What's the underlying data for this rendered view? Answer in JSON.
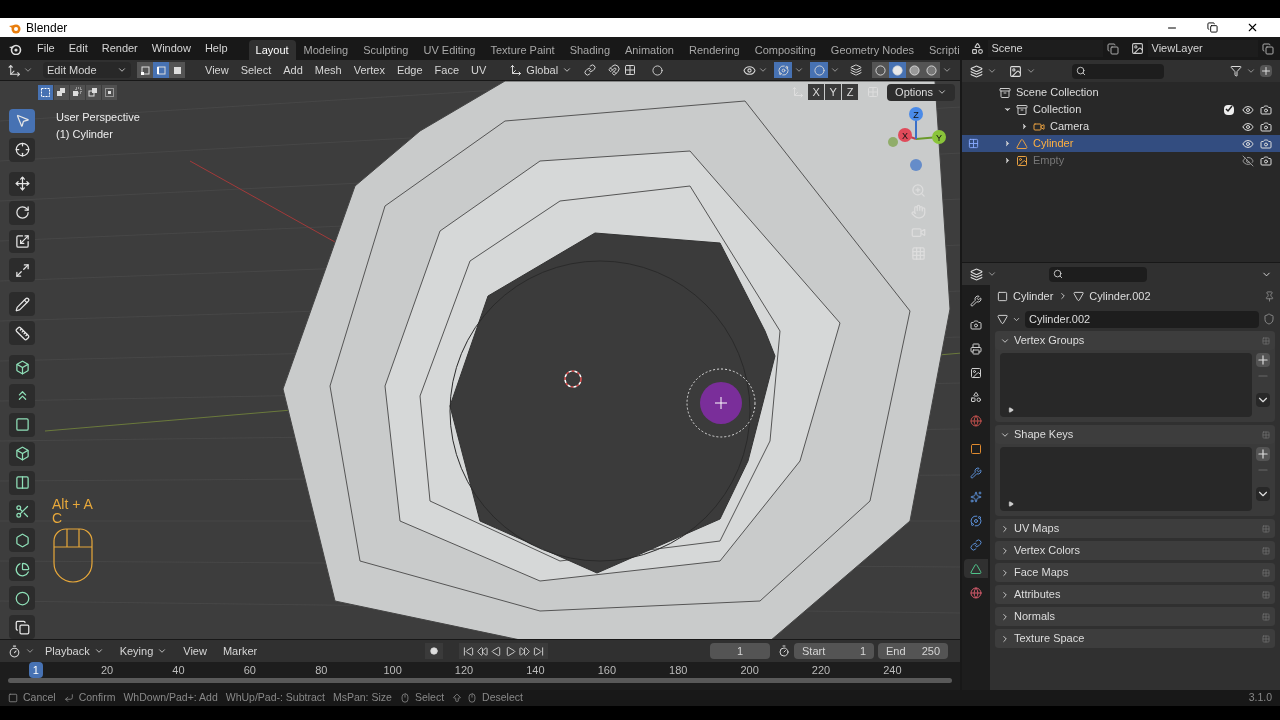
{
  "window": {
    "title": "Blender"
  },
  "menu_bar": {
    "menus": [
      "File",
      "Edit",
      "Render",
      "Window",
      "Help"
    ],
    "workspaces": [
      {
        "label": "Layout",
        "selected": true
      },
      {
        "label": "Modeling",
        "selected": false
      },
      {
        "label": "Sculpting",
        "selected": false
      },
      {
        "label": "UV Editing",
        "selected": false
      },
      {
        "label": "Texture Paint",
        "selected": false
      },
      {
        "label": "Shading",
        "selected": false
      },
      {
        "label": "Animation",
        "selected": false
      },
      {
        "label": "Rendering",
        "selected": false
      },
      {
        "label": "Compositing",
        "selected": false
      },
      {
        "label": "Geometry Nodes",
        "selected": false
      },
      {
        "label": "Scripti",
        "selected": false
      }
    ],
    "scene": "Scene",
    "view_layer": "ViewLayer"
  },
  "viewport": {
    "mode": "Edit Mode",
    "select_modes": [
      {
        "kind": "vertex",
        "selected": false
      },
      {
        "kind": "edge",
        "selected": true
      },
      {
        "kind": "face",
        "selected": false
      }
    ],
    "menus": [
      "View",
      "Select",
      "Add",
      "Mesh",
      "Vertex",
      "Edge",
      "Face",
      "UV"
    ],
    "orientation": "Global",
    "shading": [
      {
        "kind": "wireframe",
        "selected": false
      },
      {
        "kind": "solid",
        "selected": true
      },
      {
        "kind": "material",
        "selected": false
      },
      {
        "kind": "rendered",
        "selected": false
      }
    ],
    "box_modes": [
      {
        "kind": "set",
        "selected": true
      },
      {
        "kind": "extend",
        "selected": false
      },
      {
        "kind": "subtract",
        "selected": false
      },
      {
        "kind": "invert",
        "selected": false
      },
      {
        "kind": "intersect",
        "selected": false
      }
    ],
    "mirror_axes": [
      "X",
      "Y",
      "Z"
    ],
    "options": "Options",
    "view_name": "User Perspective",
    "object_name": "(1) Cylinder",
    "key_hint": [
      "Alt + A",
      "C"
    ],
    "gizmo_axes": [
      "X",
      "Y",
      "Z"
    ],
    "tools": [
      {
        "kind": "select",
        "selected": true
      },
      {
        "kind": "cursor",
        "selected": false
      },
      {
        "kind": "move",
        "selected": false
      },
      {
        "kind": "rotate",
        "selected": false
      },
      {
        "kind": "scale",
        "selected": false
      },
      {
        "kind": "transform",
        "selected": false
      },
      {
        "kind": "annotate",
        "selected": false
      },
      {
        "kind": "measure",
        "selected": false
      },
      {
        "kind": "add_cube",
        "selected": false
      },
      {
        "kind": "extrude",
        "selected": false
      },
      {
        "kind": "inset",
        "selected": false
      },
      {
        "kind": "bevel",
        "selected": false
      },
      {
        "kind": "loop_cut",
        "selected": false
      },
      {
        "kind": "knife",
        "selected": false
      },
      {
        "kind": "poly_build",
        "selected": false
      },
      {
        "kind": "spin",
        "selected": false
      },
      {
        "kind": "smooth",
        "selected": false
      },
      {
        "kind": "shear",
        "selected": false
      }
    ]
  },
  "outliner": {
    "tree": [
      {
        "label": "Scene Collection",
        "kind": "scene_collection",
        "selected": false,
        "children": [
          {
            "label": "Collection",
            "kind": "collection",
            "expanded": true,
            "checked": true,
            "visible": true,
            "selected": false,
            "children": [
              {
                "label": "Camera",
                "kind": "camera",
                "expanded": false,
                "visible": true,
                "selected": false,
                "editing": false
              }
            ]
          },
          {
            "label": "Cylinder",
            "kind": "mesh",
            "expanded": false,
            "visible": true,
            "selected": true,
            "editing": true
          },
          {
            "label": "Empty",
            "kind": "image",
            "expanded": false,
            "visible": false,
            "selected": false,
            "editing": false
          }
        ]
      }
    ]
  },
  "properties": {
    "tabs": [
      {
        "kind": "tool",
        "selected": false
      },
      {
        "kind": "render",
        "selected": false
      },
      {
        "kind": "output",
        "selected": false
      },
      {
        "kind": "view_layer",
        "selected": false
      },
      {
        "kind": "scene",
        "selected": false
      },
      {
        "kind": "world",
        "selected": false
      },
      {
        "kind": "object",
        "selected": false
      },
      {
        "kind": "modifiers",
        "selected": false
      },
      {
        "kind": "particles",
        "selected": false
      },
      {
        "kind": "physics",
        "selected": false
      },
      {
        "kind": "constraints",
        "selected": false
      },
      {
        "kind": "data",
        "selected": true
      },
      {
        "kind": "material",
        "selected": false
      }
    ],
    "breadcrumb": [
      "Cylinder",
      "Cylinder.002"
    ],
    "datablock": "Cylinder.002",
    "panels": [
      {
        "title": "Vertex Groups",
        "expanded": true
      },
      {
        "title": "Shape Keys",
        "expanded": true
      },
      {
        "title": "UV Maps",
        "expanded": false
      },
      {
        "title": "Vertex Colors",
        "expanded": false
      },
      {
        "title": "Face Maps",
        "expanded": false
      },
      {
        "title": "Attributes",
        "expanded": false
      },
      {
        "title": "Normals",
        "expanded": false
      },
      {
        "title": "Texture Space",
        "expanded": false
      }
    ]
  },
  "timeline": {
    "menus": [
      {
        "label": "Playback",
        "kind": "dropdown"
      },
      {
        "label": "Keying",
        "kind": "dropdown"
      },
      {
        "label": "View",
        "kind": "plain"
      },
      {
        "label": "Marker",
        "kind": "plain"
      }
    ],
    "current_frame": "1",
    "start_label": "Start",
    "start": "1",
    "end_label": "End",
    "end": "250",
    "ruler": [
      {
        "label": "1",
        "selected": true
      },
      {
        "label": "20",
        "selected": false
      },
      {
        "label": "40",
        "selected": false
      },
      {
        "label": "60",
        "selected": false
      },
      {
        "label": "80",
        "selected": false
      },
      {
        "label": "100",
        "selected": false
      },
      {
        "label": "120",
        "selected": false
      },
      {
        "label": "140",
        "selected": false
      },
      {
        "label": "160",
        "selected": false
      },
      {
        "label": "180",
        "selected": false
      },
      {
        "label": "200",
        "selected": false
      },
      {
        "label": "220",
        "selected": false
      },
      {
        "label": "240",
        "selected": false
      }
    ]
  },
  "status_bar": {
    "hints": [
      {
        "kind": "key",
        "label": "Cancel"
      },
      {
        "kind": "enter",
        "label": "Confirm"
      },
      {
        "kind": "text",
        "label": "WhDown/Pad+: Add"
      },
      {
        "kind": "text",
        "label": "WhUp/Pad-: Subtract"
      },
      {
        "kind": "text",
        "label": "MsPan: Size"
      },
      {
        "kind": "mouse",
        "label": "Select"
      },
      {
        "kind": "shift_mouse",
        "label": "Deselect"
      }
    ],
    "version": "3.1.0"
  }
}
